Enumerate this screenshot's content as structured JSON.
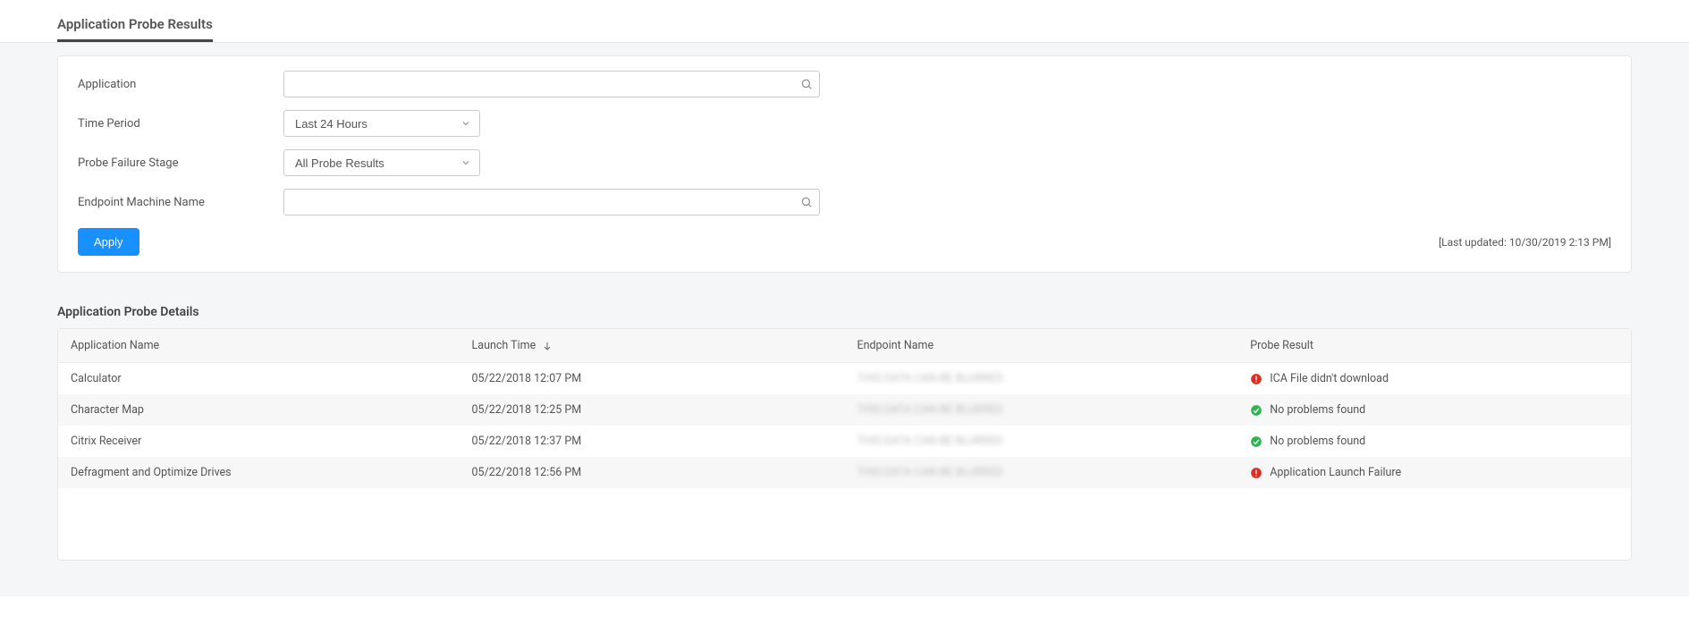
{
  "tabs": {
    "active_label": "Application Probe Results"
  },
  "filters": {
    "application_label": "Application",
    "application_value": "",
    "application_placeholder": "",
    "time_period_label": "Time Period",
    "time_period_value": "Last 24 Hours",
    "probe_stage_label": "Probe Failure Stage",
    "probe_stage_value": "All Probe Results",
    "endpoint_label": "Endpoint Machine Name",
    "endpoint_value": "",
    "endpoint_placeholder": "",
    "apply_label": "Apply",
    "last_updated": "[Last updated: 10/30/2019 2:13 PM]"
  },
  "details": {
    "heading": "Application Probe Details",
    "columns": {
      "app": "Application Name",
      "launch": "Launch Time",
      "endpoint": "Endpoint Name",
      "result": "Probe Result"
    },
    "rows": [
      {
        "app": "Calculator",
        "launch": "05/22/2018 12:07 PM",
        "endpoint": "THIS DATA CAN BE BLURRED",
        "result_status": "error",
        "result_text": "ICA File didn't download"
      },
      {
        "app": "Character Map",
        "launch": "05/22/2018 12:25 PM",
        "endpoint": "THIS DATA CAN BE BLURRED",
        "result_status": "success",
        "result_text": "No problems found"
      },
      {
        "app": "Citrix Receiver",
        "launch": "05/22/2018 12:37 PM",
        "endpoint": "THIS DATA CAN BE BLURRED",
        "result_status": "success",
        "result_text": "No problems found"
      },
      {
        "app": "Defragment and Optimize Drives",
        "launch": "05/22/2018 12:56 PM",
        "endpoint": "THIS DATA CAN BE BLURRED",
        "result_status": "error",
        "result_text": "Application Launch Failure"
      }
    ]
  },
  "icons": {
    "search": "search-icon",
    "chevron_down": "chevron-down-icon",
    "sort_down": "arrow-down-icon",
    "error": "error-circle-icon",
    "success": "check-circle-icon"
  }
}
